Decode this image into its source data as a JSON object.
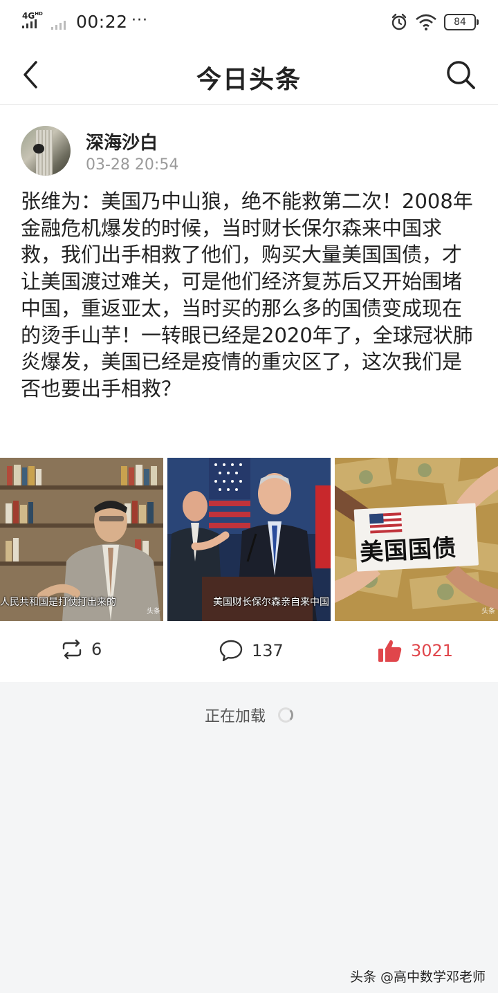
{
  "status_bar": {
    "network": "4G",
    "network_sup": "HD",
    "time": "00:22",
    "more": "···",
    "battery": "84"
  },
  "nav": {
    "title": "今日头条"
  },
  "post": {
    "author": "深海沙白",
    "time": "03-28 20:54",
    "text": "张维为：美国乃中山狼，绝不能救第二次！2008年金融危机爆发的时候，当时财长保尔森来中国求救，我们出手相救了他们，购买大量美国国债，才让美国渡过难关，可是他们经济复苏后又开始围堵中国，重返亚太，当时买的那么多的国债变成现在的烫手山芋！一转眼已经是2020年了，全球冠状肺炎爆发，美国已经是疫情的重灾区了，这次我们是否也要出手相救？",
    "images": [
      {
        "caption": "人民共和国是打仗打出来的",
        "watermark": "头条"
      },
      {
        "caption": "美国财长保尔森亲自来中国",
        "watermark": ""
      },
      {
        "sign": "美国国债",
        "watermark": "头条"
      }
    ]
  },
  "actions": {
    "repost_count": "6",
    "comment_count": "137",
    "like_count": "3021"
  },
  "loading_text": "正在加载",
  "watermark": "头条 @高中数学邓老师",
  "colors": {
    "like": "#e0464b",
    "background": "#f4f5f6"
  }
}
